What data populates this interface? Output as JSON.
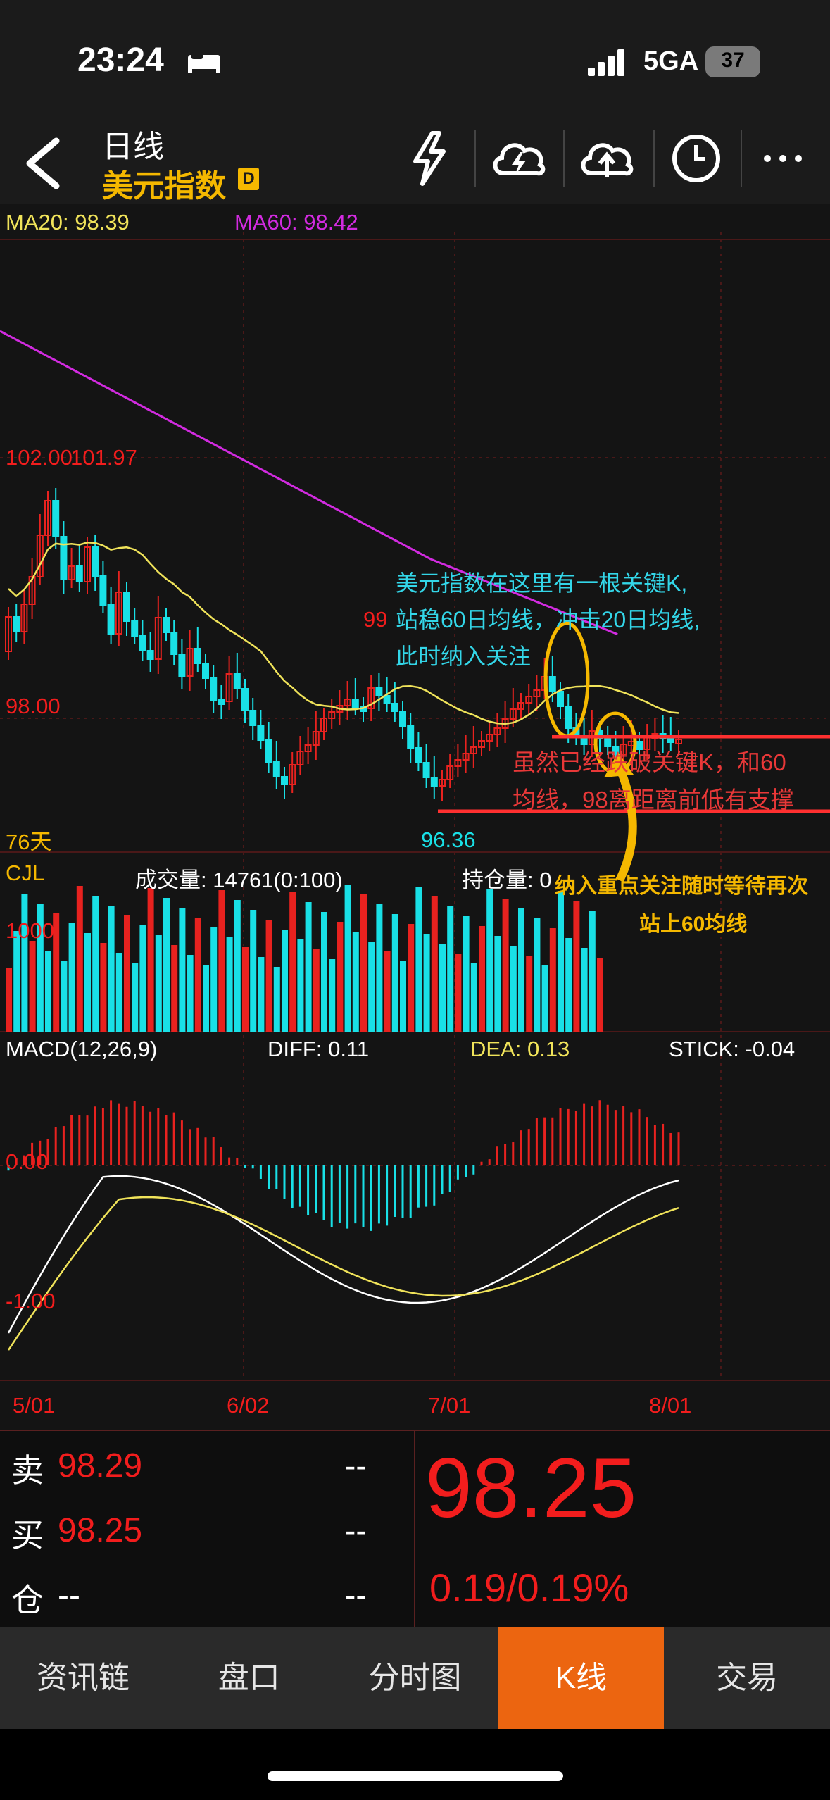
{
  "status_bar": {
    "time": "23:24",
    "network": "5GA",
    "battery": "37"
  },
  "header": {
    "title": "日线",
    "symbol": "美元指数",
    "badge": "D"
  },
  "indicators": {
    "ma20": "MA20: 98.39",
    "ma60": "MA60: 98.42"
  },
  "main_chart": {
    "price_labels": [
      "102.00",
      "101.97",
      "99",
      "98.00",
      "96.36"
    ],
    "days_label": "76天"
  },
  "volume": {
    "label": "CJL",
    "volume_text": "成交量: 14761(0:100)",
    "oi_text": "持仓量: 0",
    "axis_label": "1000"
  },
  "macd": {
    "label": "MACD(12,26,9)",
    "diff": "DIFF: 0.11",
    "dea": "DEA: 0.13",
    "stick": "STICK: -0.04",
    "zero": "0.00",
    "neg": "-1.00"
  },
  "dates": [
    "5/01",
    "6/02",
    "7/01",
    "8/01"
  ],
  "annotations": {
    "note1": [
      "美元指数在这里有一根关键K,",
      "站稳60日均线，冲击20日均线,",
      "此时纳入关注"
    ],
    "note2": [
      "虽然已经跌破关键K，和60",
      "均线，98离距离前低有支撑"
    ],
    "note3": [
      "纳入重点关注随时等待再次",
      "站上60均线"
    ]
  },
  "quote": {
    "sell_label": "卖",
    "sell_price": "98.29",
    "sell_qty": "--",
    "buy_label": "买",
    "buy_price": "98.25",
    "buy_qty": "--",
    "pos_label": "仓",
    "pos_value": "--",
    "pos_qty": "--",
    "last_price": "98.25",
    "change": "0.19/0.19%"
  },
  "tabs": [
    "资讯链",
    "盘口",
    "分时图",
    "K线",
    "交易"
  ],
  "colors": {
    "up": "#e8221f",
    "down": "#19e0e6",
    "ma20": "#f0e35a",
    "ma60": "#d22be0",
    "accent": "#ec6510",
    "gold": "#f5b800"
  }
}
